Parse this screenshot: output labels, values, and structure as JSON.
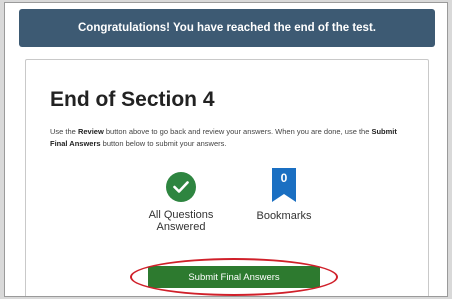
{
  "banner": {
    "text": "Congratulations! You have reached the end of the test."
  },
  "section": {
    "title": "End of Section 4",
    "instructions": {
      "part1": "Use the ",
      "review_label": "Review",
      "part2": " button above to go back and review your answers. When you are done, use the ",
      "submit_label": "Submit Final Answers",
      "part3": " button below to submit your answers."
    }
  },
  "stats": {
    "answered_label": "All Questions Answered",
    "bookmarks_count": "0",
    "bookmarks_label": "Bookmarks"
  },
  "actions": {
    "submit_label": "Submit Final Answers"
  },
  "colors": {
    "banner": "#3d5a73",
    "check_green": "#2e8540",
    "bookmark_blue": "#1a6fc2",
    "submit_green": "#2d7a2f",
    "highlight_red": "#d0202a"
  },
  "icons": {
    "answered": "checkmark-circle-icon",
    "bookmarks": "bookmark-icon"
  }
}
